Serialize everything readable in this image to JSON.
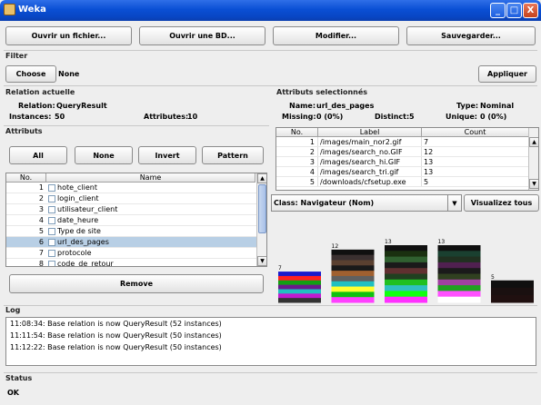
{
  "window": {
    "title": "Weka",
    "minimize_glyph": "_",
    "maximize_glyph": "□",
    "close_glyph": "X"
  },
  "toolbar": {
    "open_file": "Ouvrir un fichier...",
    "open_db": "Ouvrir une BD...",
    "edit": "Modifier...",
    "save": "Sauvegarder..."
  },
  "filter": {
    "label": "Filter",
    "choose_button": "Choose",
    "value": "None",
    "apply_button": "Appliquer"
  },
  "relation": {
    "section_label": "Relation actuelle",
    "relation_label": "Relation:",
    "relation_value": "QueryResult",
    "instances_label": "Instances:",
    "instances_value": "50",
    "attributes_label": "Attributes:",
    "attributes_value": "10"
  },
  "attributes": {
    "section_label": "Attributs",
    "btn_all": "All",
    "btn_none": "None",
    "btn_invert": "Invert",
    "btn_pattern": "Pattern",
    "col_no": "No.",
    "col_name": "Name",
    "rows": [
      {
        "no": "1",
        "name": "hote_client"
      },
      {
        "no": "2",
        "name": "login_client"
      },
      {
        "no": "3",
        "name": "utilisateur_client"
      },
      {
        "no": "4",
        "name": "date_heure"
      },
      {
        "no": "5",
        "name": "Type de site"
      },
      {
        "no": "6",
        "name": "url_des_pages"
      },
      {
        "no": "7",
        "name": "protocole"
      },
      {
        "no": "8",
        "name": "code_de_retour"
      }
    ],
    "remove_button": "Remove"
  },
  "selected": {
    "section_label": "Attributs selectionnés",
    "name_label": "Name:",
    "name_value": "url_des_pages",
    "type_label": "Type:",
    "type_value": "Nominal",
    "missing_label": "Missing:",
    "missing_value": "0 (0%)",
    "distinct_label": "Distinct:",
    "distinct_value": "5",
    "unique_label": "Unique:",
    "unique_value": "0 (0%)",
    "col_no": "No.",
    "col_label": "Label",
    "col_count": "Count",
    "rows": [
      {
        "no": "1",
        "label": "/images/main_nor2.gif",
        "count": "7"
      },
      {
        "no": "2",
        "label": "/images/search_no.GIF",
        "count": "12"
      },
      {
        "no": "3",
        "label": "/images/search_hi.GIF",
        "count": "13"
      },
      {
        "no": "4",
        "label": "/images/search_tri.gif",
        "count": "13"
      },
      {
        "no": "5",
        "label": "/downloads/cfsetup.exe",
        "count": "5"
      }
    ]
  },
  "class": {
    "value": "Class: Navigateur (Nom)",
    "visualize_button": "Visualizez tous"
  },
  "log": {
    "label": "Log",
    "lines": [
      "11:08:34: Base relation is now QueryResult (52 instances)",
      "11:11:54: Base relation is now QueryResult (50 instances)",
      "11:12:22: Base relation is now QueryResult (50 instances)"
    ]
  },
  "status": {
    "label": "Status",
    "value": "OK"
  }
}
